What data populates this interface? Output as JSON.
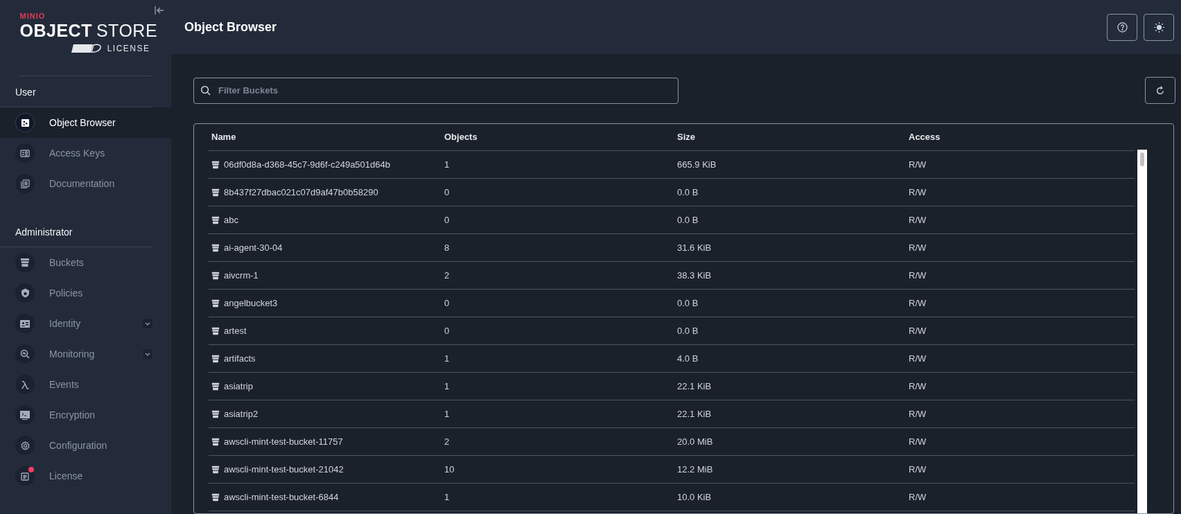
{
  "logo": {
    "brand": "MINIO",
    "product_bold": "OBJECT",
    "product_light": "STORE",
    "license": "LICENSE"
  },
  "sidebar": {
    "sections": [
      {
        "title": "User",
        "items": [
          {
            "label": "Object Browser",
            "selected": true,
            "expandable": false,
            "alert": false
          },
          {
            "label": "Access Keys",
            "selected": false,
            "expandable": false,
            "alert": false
          },
          {
            "label": "Documentation",
            "selected": false,
            "expandable": false,
            "alert": false
          }
        ]
      },
      {
        "title": "Administrator",
        "items": [
          {
            "label": "Buckets",
            "selected": false,
            "expandable": false,
            "alert": false
          },
          {
            "label": "Policies",
            "selected": false,
            "expandable": false,
            "alert": false
          },
          {
            "label": "Identity",
            "selected": false,
            "expandable": true,
            "alert": false
          },
          {
            "label": "Monitoring",
            "selected": false,
            "expandable": true,
            "alert": false
          },
          {
            "label": "Events",
            "selected": false,
            "expandable": false,
            "alert": false
          },
          {
            "label": "Encryption",
            "selected": false,
            "expandable": false,
            "alert": false
          },
          {
            "label": "Configuration",
            "selected": false,
            "expandable": false,
            "alert": false
          },
          {
            "label": "License",
            "selected": false,
            "expandable": false,
            "alert": true
          }
        ]
      }
    ]
  },
  "header": {
    "title": "Object Browser"
  },
  "search": {
    "placeholder": "Filter Buckets"
  },
  "table": {
    "columns": [
      "Name",
      "Objects",
      "Size",
      "Access"
    ],
    "rows": [
      [
        "06df0d8a-d368-45c7-9d6f-c249a501d64b",
        "1",
        "665.9 KiB",
        "R/W"
      ],
      [
        "8b437f27dbac021c07d9af47b0b58290",
        "0",
        "0.0 B",
        "R/W"
      ],
      [
        "abc",
        "0",
        "0.0 B",
        "R/W"
      ],
      [
        "ai-agent-30-04",
        "8",
        "31.6 KiB",
        "R/W"
      ],
      [
        "aivcrm-1",
        "2",
        "38.3 KiB",
        "R/W"
      ],
      [
        "angelbucket3",
        "0",
        "0.0 B",
        "R/W"
      ],
      [
        "artest",
        "0",
        "0.0 B",
        "R/W"
      ],
      [
        "artifacts",
        "1",
        "4.0 B",
        "R/W"
      ],
      [
        "asiatrip",
        "1",
        "22.1 KiB",
        "R/W"
      ],
      [
        "asiatrip2",
        "1",
        "22.1 KiB",
        "R/W"
      ],
      [
        "awscli-mint-test-bucket-11757",
        "2",
        "20.0 MiB",
        "R/W"
      ],
      [
        "awscli-mint-test-bucket-21042",
        "10",
        "12.2 MiB",
        "R/W"
      ],
      [
        "awscli-mint-test-bucket-6844",
        "1",
        "10.0 KiB",
        "R/W"
      ]
    ]
  }
}
